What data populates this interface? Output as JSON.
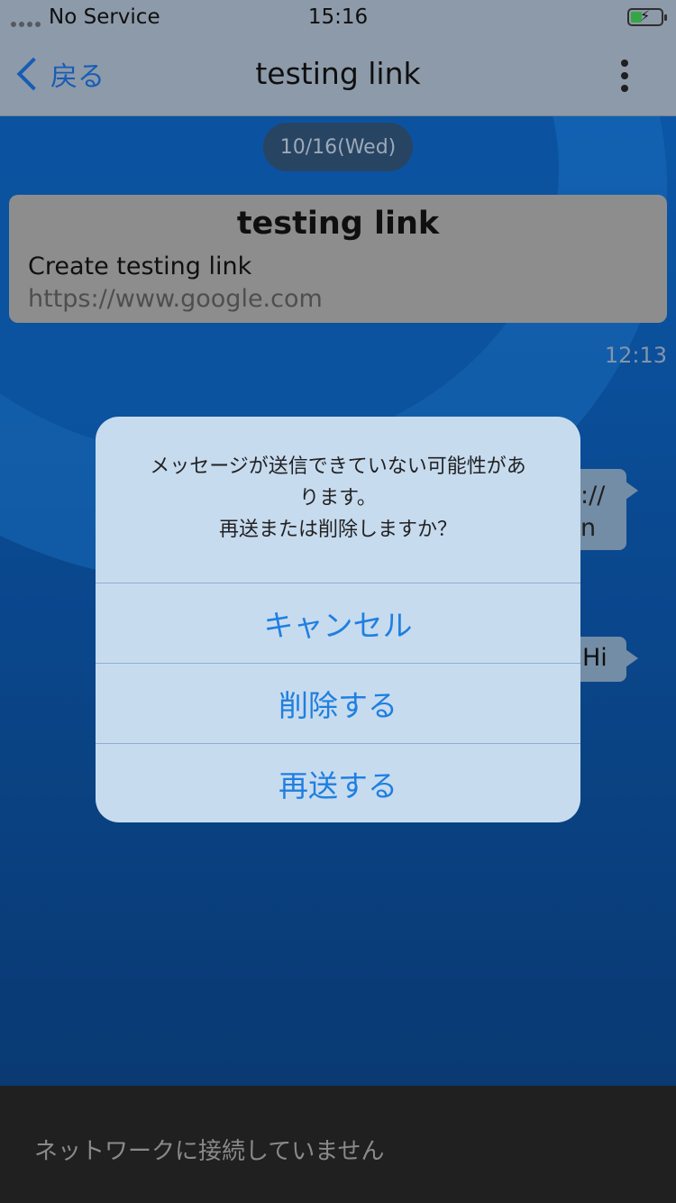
{
  "status_bar": {
    "carrier": "No Service",
    "time": "15:16"
  },
  "nav": {
    "back_label": "戻る",
    "title": "testing link"
  },
  "chat": {
    "date_chip": "10/16(Wed)",
    "link_card": {
      "title": "testing link",
      "description": "Create testing link",
      "url": "https://www.google.com"
    },
    "message_time": "12:13",
    "bubble1_text_line1": "://",
    "bubble1_text_line2": "n",
    "bubble2_text": "Hi"
  },
  "alert": {
    "message_line1": "メッセージが送信できていない可能性があ",
    "message_line2": "ります。",
    "message_line3": "再送または削除しますか？",
    "cancel_label": "キャンセル",
    "delete_label": "削除する",
    "resend_label": "再送する"
  },
  "bottom": {
    "network_status": "ネットワークに接続していません"
  }
}
